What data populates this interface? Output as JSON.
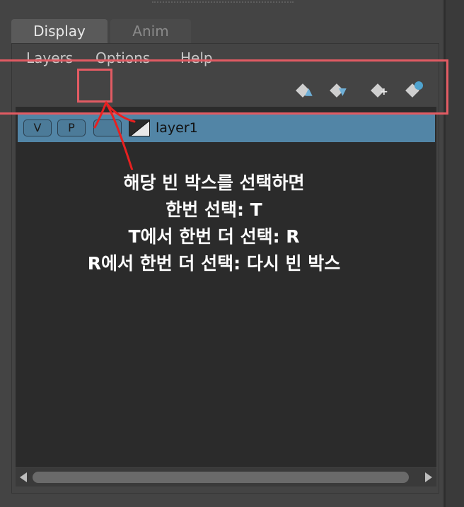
{
  "tabs": [
    {
      "label": "Display",
      "active": true
    },
    {
      "label": "Anim",
      "active": false
    }
  ],
  "menu": {
    "layers": "Layers",
    "options": "Options",
    "help": "Help"
  },
  "toolbar": {
    "icons": [
      "move-layer-up-icon",
      "move-layer-down-icon",
      "create-new-layer-icon",
      "create-layer-from-selected-icon"
    ]
  },
  "layer": {
    "visibility": "V",
    "playback": "P",
    "display_type": "",
    "name": "layer1"
  },
  "annotation": {
    "lines": [
      "해당 빈 박스를 선택하면",
      "한번 선택: T",
      "T에서 한번 더 선택: R",
      "R에서 한번 더 선택: 다시 빈 박스"
    ],
    "color": "#e25b63"
  },
  "colors": {
    "selected_row": "#5285a6",
    "list_background": "#2b2b2b",
    "panel_background": "#444444"
  }
}
